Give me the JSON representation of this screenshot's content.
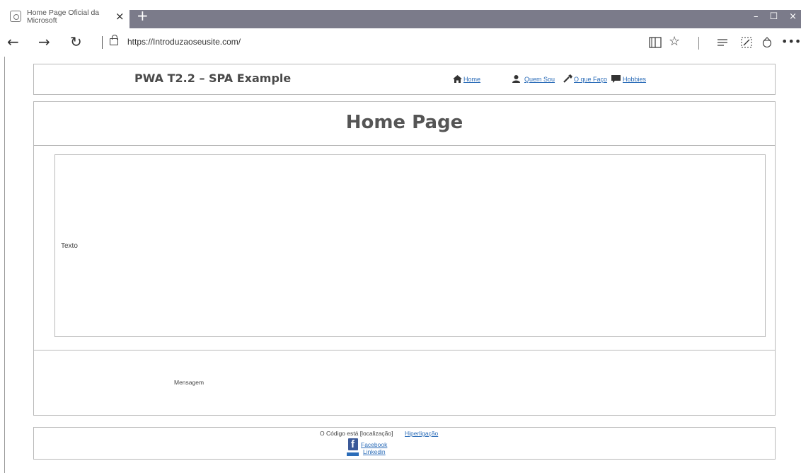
{
  "browser": {
    "tab_title": "Home Page Oficial da Microsoft",
    "tab_close": "×",
    "new_tab": "+",
    "window_controls": [
      "–",
      "☐",
      "×"
    ],
    "back": "←",
    "forward": "→",
    "refresh": "↻",
    "url": "https://Introduzaoseusite.com/",
    "toolbar_icons": [
      "reading-view-icon",
      "favorite-star-icon",
      "hub-icon",
      "web-note-icon",
      "share-icon",
      "more-icon"
    ]
  },
  "header": {
    "site_title": "PWA T2.2 – SPA Example",
    "nav": [
      {
        "label": "Home",
        "icon": "home-icon"
      },
      {
        "label": "Quem Sou",
        "icon": "user-icon"
      },
      {
        "label": "O que Faço",
        "icon": "wrench-icon"
      },
      {
        "label": "Hobbies",
        "icon": "chat-icon"
      }
    ]
  },
  "main": {
    "title": "Home Page",
    "content_text": "Texto",
    "message": "Mensagem"
  },
  "footer": {
    "code_location": "O Código está [localização]",
    "hyperlink": "Hiperligação",
    "facebook": "Facebook",
    "linkedin": "Linkedin"
  }
}
